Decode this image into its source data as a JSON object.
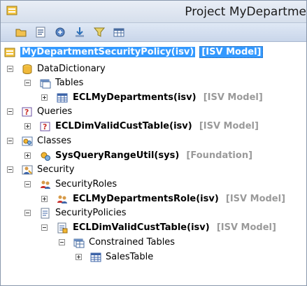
{
  "window": {
    "title": "Project MyDepartme"
  },
  "toolbar": {
    "buttons": [
      "open-icon",
      "properties-icon",
      "compile-icon",
      "import-icon",
      "filter-icon",
      "table-icon"
    ]
  },
  "tree": {
    "root": {
      "label": "MyDepartmentSecurityPolicy(isv)",
      "layer": "[ISV Model]"
    },
    "data_dictionary": "DataDictionary",
    "tables": "Tables",
    "ecl_my_departments": {
      "label": "ECLMyDepartments(isv)",
      "layer": "[ISV Model]"
    },
    "queries": "Queries",
    "ecl_dim_valid_cust_table_query": {
      "label": "ECLDimValidCustTable(isv)",
      "layer": "[ISV Model]"
    },
    "classes": "Classes",
    "sys_query_range_util": {
      "label": "SysQueryRangeUtil(sys)",
      "layer": "[Foundation]"
    },
    "security": "Security",
    "security_roles": "SecurityRoles",
    "ecl_my_departments_role": {
      "label": "ECLMyDepartmentsRole(isv)",
      "layer": "[ISV Model]"
    },
    "security_policies": "SecurityPolicies",
    "ecl_dim_valid_cust_table_policy": {
      "label": "ECLDimValidCustTable(isv)",
      "layer": "[ISV Model]"
    },
    "constrained_tables": "Constrained Tables",
    "sales_table": "SalesTable"
  }
}
